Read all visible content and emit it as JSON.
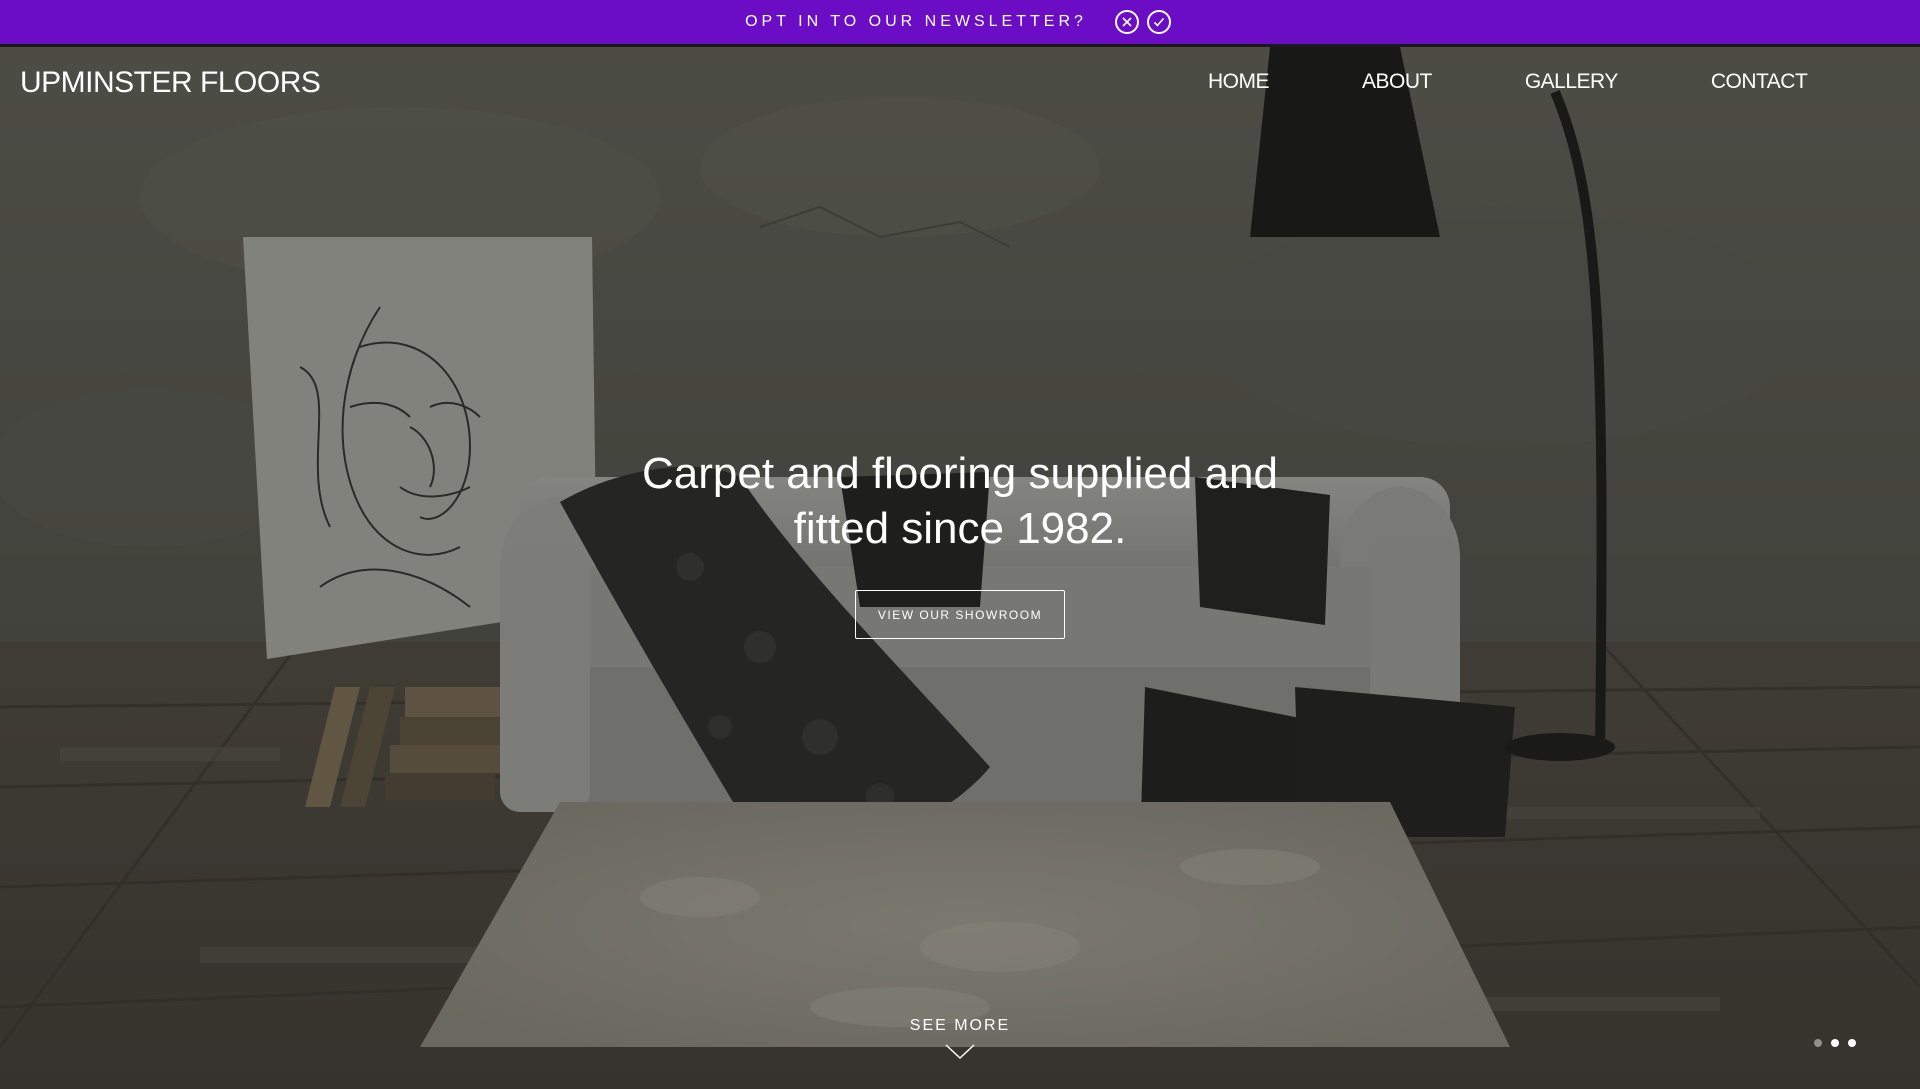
{
  "newsletter": {
    "text": "OPT IN TO OUR NEWSLETTER?",
    "decline_icon": "close-circle-icon",
    "accept_icon": "check-circle-icon",
    "background_color": "#6a0dc4"
  },
  "header": {
    "logo": "UPMINSTER FLOORS",
    "nav": [
      {
        "label": "HOME"
      },
      {
        "label": "ABOUT"
      },
      {
        "label": "GALLERY"
      },
      {
        "label": "CONTACT"
      }
    ]
  },
  "hero": {
    "headline_line1": "Carpet and flooring supplied and",
    "headline_line2": "fitted since 1982.",
    "button_label": "VIEW OUR SHOWROOM",
    "see_more": "SEE MORE",
    "see_more_icon": "chevron-down-icon",
    "slides_total": 3,
    "active_slide": 2
  }
}
